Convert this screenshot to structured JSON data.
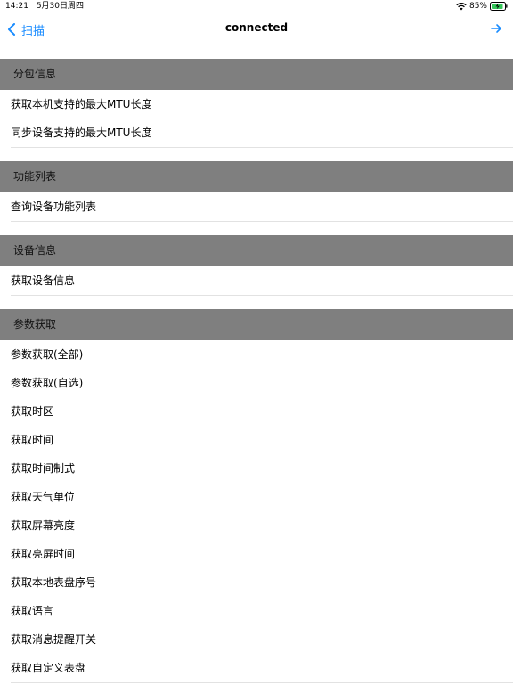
{
  "status": {
    "time": "14:21",
    "date": "5月30日周四",
    "battery": "85%"
  },
  "nav": {
    "back_label": "扫描",
    "title": "connected"
  },
  "sections": [
    {
      "header": "分包信息",
      "items": [
        "获取本机支持的最大MTU长度",
        "同步设备支持的最大MTU长度"
      ]
    },
    {
      "header": "功能列表",
      "items": [
        "查询设备功能列表"
      ]
    },
    {
      "header": "设备信息",
      "items": [
        "获取设备信息"
      ]
    },
    {
      "header": "参数获取",
      "items": [
        "参数获取(全部)",
        "参数获取(自选)",
        "获取时区",
        "获取时间",
        "获取时间制式",
        "获取天气单位",
        "获取屏幕亮度",
        "获取亮屏时间",
        "获取本地表盘序号",
        "获取语言",
        "获取消息提醒开关",
        "获取自定义表盘"
      ]
    }
  ]
}
